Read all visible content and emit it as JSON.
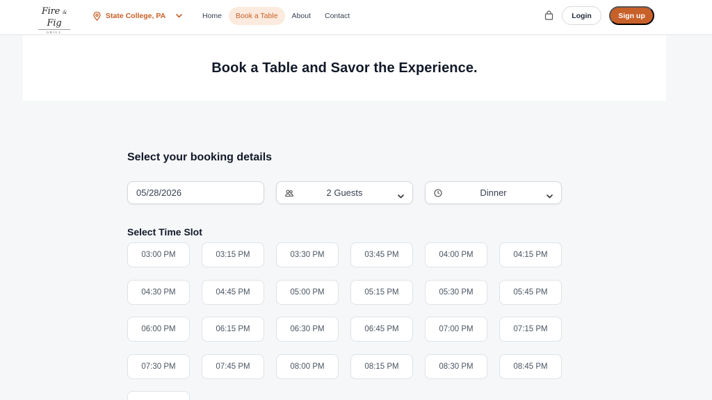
{
  "brand": {
    "name_part1": "Fire",
    "amp": "&",
    "name_part2": "Fig",
    "sub": "GRILL"
  },
  "location": {
    "label": "State College, PA"
  },
  "nav": {
    "links": [
      {
        "label": "Home"
      },
      {
        "label": "Book a Table",
        "active": true
      },
      {
        "label": "About"
      },
      {
        "label": "Contact"
      }
    ],
    "login_label": "Login",
    "signup_label": "Sign up"
  },
  "hero": {
    "title": "Book a Table and Savor the Experience."
  },
  "booking": {
    "section_title": "Select your booking details",
    "date_value": "05/28/2026",
    "guests_value": "2 Guests",
    "meal_value": "Dinner",
    "slot_title": "Select Time Slot",
    "slots": [
      "03:00 PM",
      "03:15 PM",
      "03:30 PM",
      "03:45 PM",
      "04:00 PM",
      "04:15 PM",
      "04:30 PM",
      "04:45 PM",
      "05:00 PM",
      "05:15 PM",
      "05:30 PM",
      "05:45 PM",
      "06:00 PM",
      "06:15 PM",
      "06:30 PM",
      "06:45 PM",
      "07:00 PM",
      "07:15 PM",
      "07:30 PM",
      "07:45 PM",
      "08:00 PM",
      "08:15 PM",
      "08:30 PM",
      "08:45 PM",
      ""
    ]
  },
  "colors": {
    "accent": "#c8602a",
    "active_tab_bg": "#fbeadd",
    "page_bg": "#f6f7f9"
  },
  "icons": {
    "location": "map-pin-icon",
    "chevron": "chevron-down-icon",
    "cart": "shopping-bag-icon",
    "guests": "users-icon",
    "clock": "clock-icon"
  }
}
